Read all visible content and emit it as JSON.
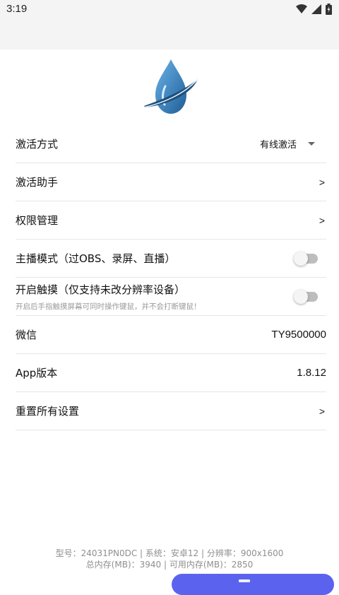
{
  "status_bar": {
    "time": "3:19"
  },
  "settings": {
    "activation_mode": {
      "label": "激活方式",
      "value": "有线激活"
    },
    "activation_helper": {
      "label": "激活助手",
      "chevron": ">"
    },
    "permission_mgmt": {
      "label": "权限管理",
      "chevron": ">"
    },
    "streamer_mode": {
      "label": "主播模式（过OBS、录屏、直播）",
      "enabled": false
    },
    "touch_mode": {
      "label": "开启触摸（仅支持未改分辨率设备）",
      "description": "开启后手指触摸屏幕可同时操作键鼠，并不会打断键鼠！",
      "enabled": false
    },
    "wechat": {
      "label": "微信",
      "value": "TY9500000"
    },
    "app_version": {
      "label": "App版本",
      "value": "1.8.12"
    },
    "reset_all": {
      "label": "重置所有设置",
      "chevron": ">"
    }
  },
  "footer": {
    "line1": "型号：24031PN0DC | 系统：安卓12 | 分辨率：900x1600",
    "line2": "总内存(MB)：3940 | 可用内存(MB)：2850"
  },
  "colors": {
    "accent": "#5b63ee",
    "logo_blue": "#2f7fc0",
    "logo_dark": "#1f4f7c"
  },
  "icons": {
    "status": [
      "wifi-icon",
      "signal-icon",
      "battery-icon"
    ],
    "logo": "water-drop-logo",
    "dropdown": "caret-down-icon",
    "fab": "menu-icon"
  }
}
